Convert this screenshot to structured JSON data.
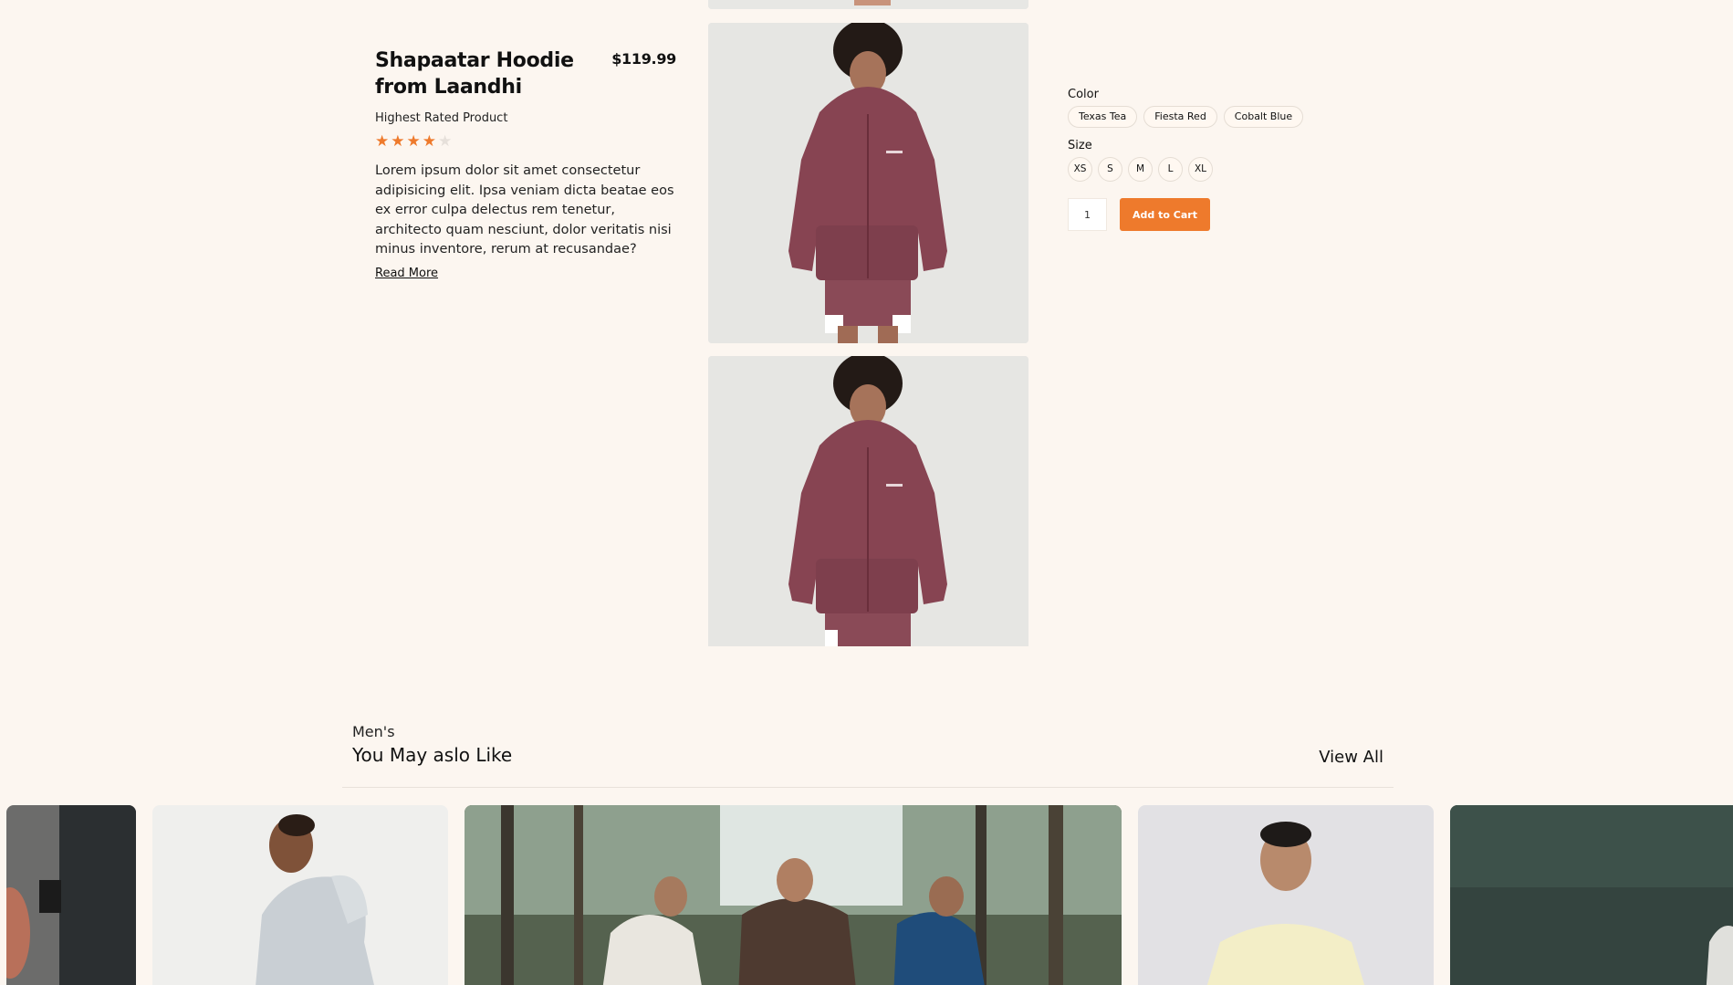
{
  "product": {
    "title": "Shapaatar Hoodie from Laandhi",
    "price": "$119.99",
    "subtitle": "Highest Rated Product",
    "rating": {
      "value": 4,
      "max": 5
    },
    "description": "Lorem ipsum dolor sit amet consectetur adipisicing elit. Ipsa veniam dicta beatae eos ex error culpa delectus rem tenetur, architecto quam nesciunt, dolor veritatis nisi minus inventore, rerum at recusandae?",
    "read_more": "Read More"
  },
  "options": {
    "color_label": "Color",
    "colors": [
      "Texas Tea",
      "Fiesta Red",
      "Cobalt Blue"
    ],
    "size_label": "Size",
    "sizes": [
      "XS",
      "S",
      "M",
      "L",
      "XL"
    ],
    "quantity": "1",
    "add_to_cart": "Add to Cart"
  },
  "related": {
    "kicker": "Men's",
    "title": "You May aslo Like",
    "view_all": "View All"
  },
  "colors": {
    "background": "#fcf6f0",
    "accent": "#ee7a2c",
    "hoodie": "#874452"
  }
}
